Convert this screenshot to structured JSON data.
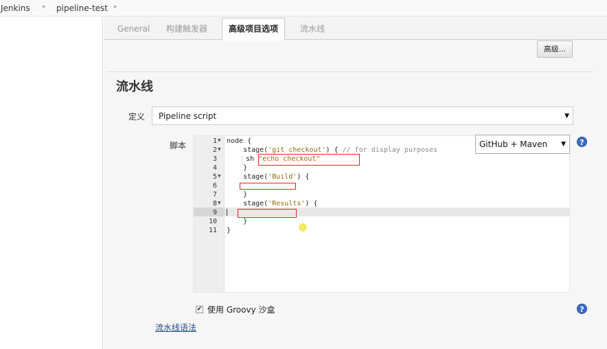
{
  "breadcrumb": {
    "items": [
      "Jenkins",
      "pipeline-test"
    ],
    "separator_icon": "chevron-right-icon"
  },
  "tabs": [
    {
      "label": "General",
      "active": false
    },
    {
      "label": "构建触发器",
      "active": false
    },
    {
      "label": "高级项目选项",
      "active": true
    },
    {
      "label": "流水线",
      "active": false
    }
  ],
  "advanced_button": "高级...",
  "section_title": "流水线",
  "definition": {
    "label": "定义",
    "value": "Pipeline script"
  },
  "script": {
    "label": "脚本",
    "lines": [
      "1",
      "2",
      "3",
      "4",
      "5",
      "6",
      "7",
      "8",
      "9",
      "10",
      "11"
    ],
    "code": {
      "l1": "node {",
      "l2_a": "    stage(",
      "l2_str": "'git checkout'",
      "l2_b": ") { ",
      "l2_cmt": "// for display purposes",
      "l3_a": "    sh ",
      "l3_str": "\"echo checkout\"",
      "l4": "    }",
      "l5_a": "    stage(",
      "l5_str": "'Build'",
      "l5_b": ") {",
      "l7": "    }",
      "l8_a": "    stage(",
      "l8_str": "'Results'",
      "l8_b": ") {",
      "l10": "    }",
      "l11": "}"
    },
    "active_line": 9,
    "sample": "GitHub + Maven"
  },
  "sandbox": {
    "checked": true,
    "label": "使用 Groovy 沙盒"
  },
  "syntax_link": "流水线语法",
  "colors": {
    "accent_link": "#204a87",
    "help_icon": "#3b6cc4",
    "annotation_red": "#e02020"
  }
}
